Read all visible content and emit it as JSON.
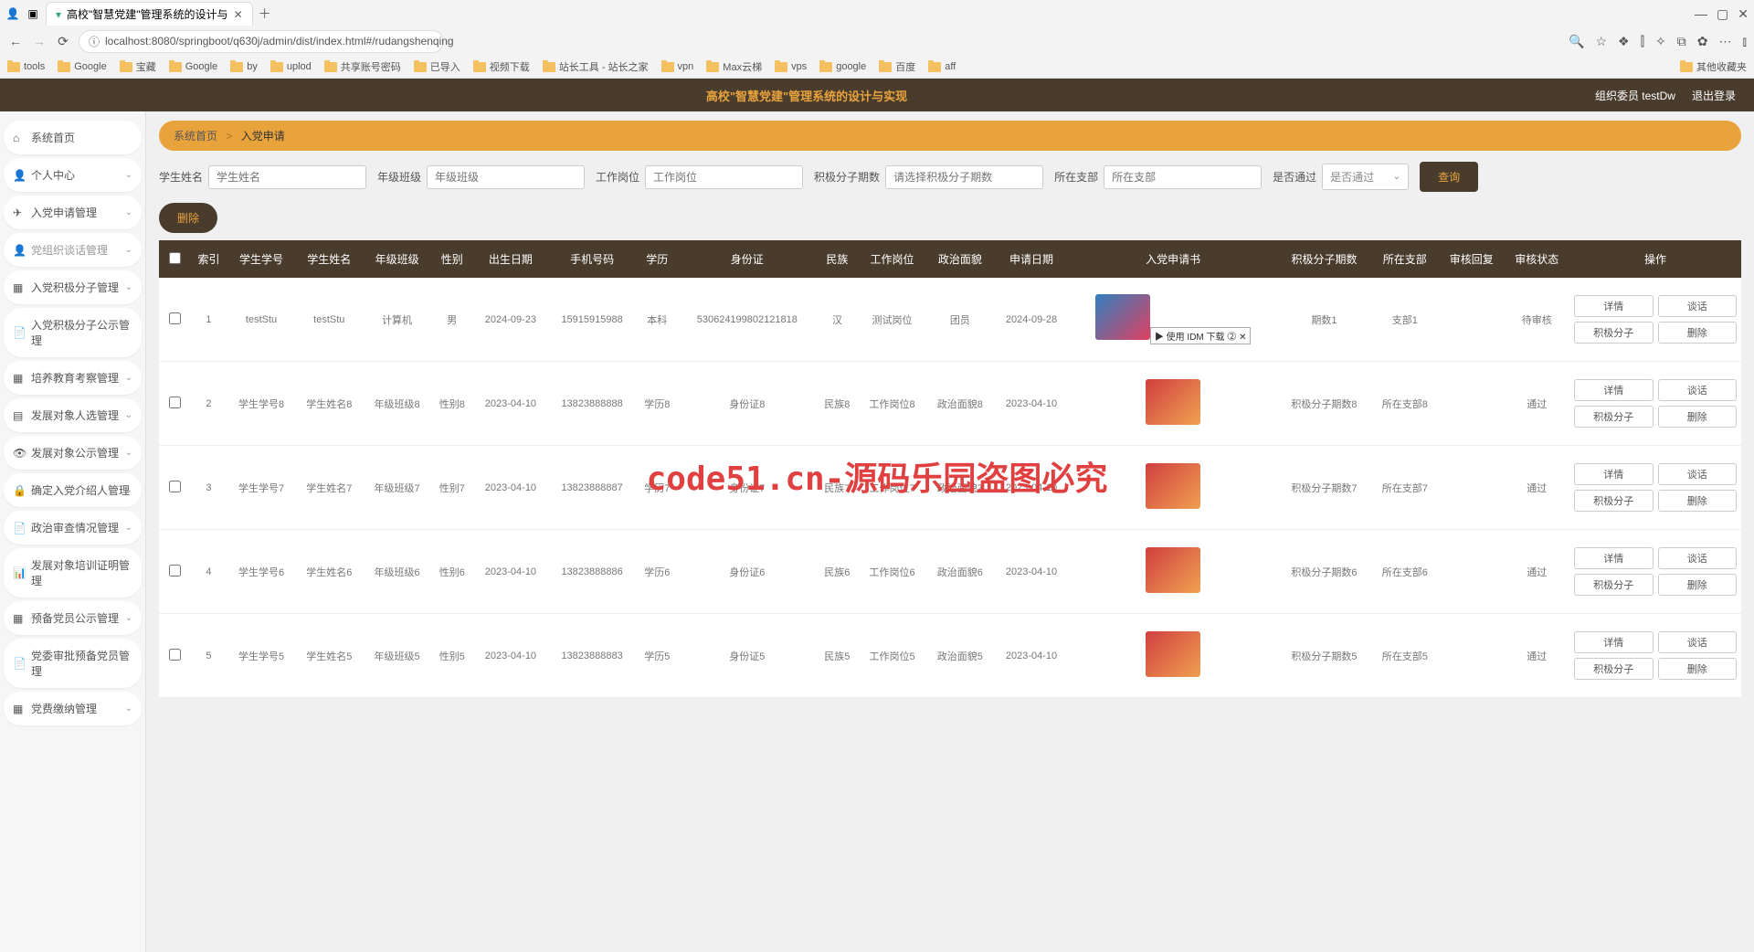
{
  "browser": {
    "tab_title": "高校\"智慧党建\"管理系统的设计与",
    "url": "localhost:8080/springboot/q630j/admin/dist/index.html#/rudangshenqing",
    "bookmarks": [
      "tools",
      "Google",
      "宝藏",
      "Google",
      "by",
      "uplod",
      "共享账号密码",
      "已导入",
      "视频下载",
      "站长工具 - 站长之家",
      "vpn",
      "Max云梯",
      "vps",
      "google",
      "百度",
      "aff"
    ],
    "bookmark_overflow": "其他收藏夹"
  },
  "app": {
    "title": "高校\"智慧党建\"管理系统的设计与实现",
    "user_label": "组织委员 testDw",
    "logout": "退出登录"
  },
  "sidebar": [
    {
      "icon": "home",
      "label": "系统首页",
      "chev": false
    },
    {
      "icon": "user",
      "label": "个人中心",
      "chev": true
    },
    {
      "icon": "send",
      "label": "入党申请管理",
      "chev": true
    },
    {
      "icon": "user",
      "label": "党组织谈话管理",
      "chev": true,
      "dim": true
    },
    {
      "icon": "grid",
      "label": "入党积极分子管理",
      "chev": true
    },
    {
      "icon": "doc",
      "label": "入党积极分子公示管理",
      "chev": false
    },
    {
      "icon": "grid",
      "label": "培养教育考察管理",
      "chev": true
    },
    {
      "icon": "bars",
      "label": "发展对象人选管理",
      "chev": true
    },
    {
      "icon": "eye",
      "label": "发展对象公示管理",
      "chev": true
    },
    {
      "icon": "lock",
      "label": "确定入党介绍人管理",
      "chev": true
    },
    {
      "icon": "doc",
      "label": "政治审查情况管理",
      "chev": true
    },
    {
      "icon": "chart",
      "label": "发展对象培训证明管理",
      "chev": false
    },
    {
      "icon": "grid",
      "label": "预备党员公示管理",
      "chev": true
    },
    {
      "icon": "doc",
      "label": "党委审批预备党员管理",
      "chev": false
    },
    {
      "icon": "grid",
      "label": "党费缴纳管理",
      "chev": true
    }
  ],
  "breadcrumb": {
    "home": "系统首页",
    "sep": ">",
    "current": "入党申请"
  },
  "search": {
    "name_label": "学生姓名",
    "name_ph": "学生姓名",
    "class_label": "年级班级",
    "class_ph": "年级班级",
    "job_label": "工作岗位",
    "job_ph": "工作岗位",
    "period_label": "积极分子期数",
    "period_ph": "请选择积极分子期数",
    "branch_label": "所在支部",
    "branch_ph": "所在支部",
    "pass_label": "是否通过",
    "pass_ph": "是否通过",
    "query_btn": "查询"
  },
  "delete_btn": "删除",
  "columns": [
    "",
    "索引",
    "学生学号",
    "学生姓名",
    "年级班级",
    "性别",
    "出生日期",
    "手机号码",
    "学历",
    "身份证",
    "民族",
    "工作岗位",
    "政治面貌",
    "申请日期",
    "入党申请书",
    "积极分子期数",
    "所在支部",
    "审核回复",
    "审核状态",
    "操作"
  ],
  "rows": [
    {
      "idx": "1",
      "sno": "testStu",
      "sname": "testStu",
      "class": "计算机",
      "sex": "男",
      "birth": "2024-09-23",
      "phone": "15915915988",
      "edu": "本科",
      "idcard": "530624199802121818",
      "nation": "汉",
      "job": "测试岗位",
      "pol": "团员",
      "apply": "2024-09-28",
      "thumb": "v2",
      "idm": "▶ 使用 IDM 下载  ⓶ ✕",
      "period": "期数1",
      "branch": "支部1",
      "reply": "",
      "status": "待审核"
    },
    {
      "idx": "2",
      "sno": "学生学号8",
      "sname": "学生姓名8",
      "class": "年级班级8",
      "sex": "性别8",
      "birth": "2023-04-10",
      "phone": "13823888888",
      "edu": "学历8",
      "idcard": "身份证8",
      "nation": "民族8",
      "job": "工作岗位8",
      "pol": "政治面貌8",
      "apply": "2023-04-10",
      "thumb": "v1",
      "idm": "",
      "period": "积极分子期数8",
      "branch": "所在支部8",
      "reply": "",
      "status": "通过"
    },
    {
      "idx": "3",
      "sno": "学生学号7",
      "sname": "学生姓名7",
      "class": "年级班级7",
      "sex": "性别7",
      "birth": "2023-04-10",
      "phone": "13823888887",
      "edu": "学历7",
      "idcard": "身份证7",
      "nation": "民族7",
      "job": "工作岗位7",
      "pol": "政治面貌7",
      "apply": "2023-04-10",
      "thumb": "v1",
      "idm": "",
      "period": "积极分子期数7",
      "branch": "所在支部7",
      "reply": "",
      "status": "通过"
    },
    {
      "idx": "4",
      "sno": "学生学号6",
      "sname": "学生姓名6",
      "class": "年级班级6",
      "sex": "性别6",
      "birth": "2023-04-10",
      "phone": "13823888886",
      "edu": "学历6",
      "idcard": "身份证6",
      "nation": "民族6",
      "job": "工作岗位6",
      "pol": "政治面貌6",
      "apply": "2023-04-10",
      "thumb": "v1",
      "idm": "",
      "period": "积极分子期数6",
      "branch": "所在支部6",
      "reply": "",
      "status": "通过"
    },
    {
      "idx": "5",
      "sno": "学生学号5",
      "sname": "学生姓名5",
      "class": "年级班级5",
      "sex": "性别5",
      "birth": "2023-04-10",
      "phone": "13823888883",
      "edu": "学历5",
      "idcard": "身份证5",
      "nation": "民族5",
      "job": "工作岗位5",
      "pol": "政治面貌5",
      "apply": "2023-04-10",
      "thumb": "v1",
      "idm": "",
      "period": "积极分子期数5",
      "branch": "所在支部5",
      "reply": "",
      "status": "通过"
    }
  ],
  "actions": [
    "详情",
    "谈话",
    "积极分子",
    "删除"
  ],
  "watermark": "code51.cn-源码乐园盗图必究"
}
